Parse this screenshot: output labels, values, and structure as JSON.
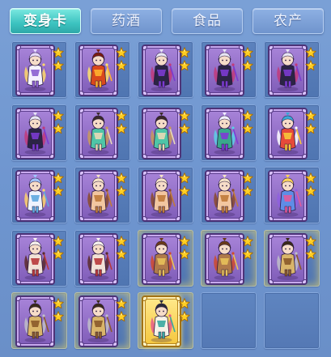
{
  "tabs": [
    {
      "label": "变身卡",
      "active": true
    },
    {
      "label": "药酒",
      "active": false
    },
    {
      "label": "食品",
      "active": false
    },
    {
      "label": "农产",
      "active": false
    }
  ],
  "colors": {
    "panel_bg": "#6f93c9",
    "tab_active": "#3cc3c0",
    "tab_inactive": "#7094cd",
    "card_purple": "#a884d9",
    "card_gold": "#f4c63c",
    "star": "#ffcf24"
  },
  "grid": {
    "columns": 5,
    "rows": 5,
    "slots": [
      {
        "state": "card",
        "frame": "purple",
        "figure": "white-purple-spirit",
        "stars": 2,
        "glow": false
      },
      {
        "state": "card",
        "frame": "purple",
        "figure": "fire-demon",
        "stars": 2,
        "glow": false
      },
      {
        "state": "card",
        "frame": "purple",
        "figure": "dark-swordsman",
        "stars": 2,
        "glow": false
      },
      {
        "state": "card",
        "frame": "purple",
        "figure": "dark-swordsman",
        "stars": 2,
        "glow": false
      },
      {
        "state": "card",
        "frame": "purple",
        "figure": "dark-swordsman",
        "stars": 2,
        "glow": false
      },
      {
        "state": "card",
        "frame": "purple",
        "figure": "dark-swordsman",
        "stars": 2,
        "glow": false
      },
      {
        "state": "card",
        "frame": "purple",
        "figure": "green-maiden",
        "stars": 2,
        "glow": false
      },
      {
        "state": "card",
        "frame": "purple",
        "figure": "green-maiden",
        "stars": 2,
        "glow": false
      },
      {
        "state": "card",
        "frame": "purple",
        "figure": "serpent-dragon",
        "stars": 2,
        "glow": false
      },
      {
        "state": "card",
        "frame": "purple",
        "figure": "lion-dance-beast",
        "stars": 2,
        "glow": false
      },
      {
        "state": "card",
        "frame": "purple",
        "figure": "white-kirin",
        "stars": 2,
        "glow": false
      },
      {
        "state": "card",
        "frame": "purple",
        "figure": "pig-monk",
        "stars": 2,
        "glow": false
      },
      {
        "state": "card",
        "frame": "purple",
        "figure": "pig-monk",
        "stars": 2,
        "glow": false
      },
      {
        "state": "card",
        "frame": "purple",
        "figure": "pig-monk",
        "stars": 2,
        "glow": false
      },
      {
        "state": "card",
        "frame": "purple",
        "figure": "blue-butterfly-fairy",
        "stars": 2,
        "glow": false
      },
      {
        "state": "card",
        "frame": "purple",
        "figure": "red-winged-demon",
        "stars": 2,
        "glow": false
      },
      {
        "state": "card",
        "frame": "purple",
        "figure": "red-winged-demon",
        "stars": 2,
        "glow": false
      },
      {
        "state": "card",
        "frame": "purple",
        "figure": "monkey-warrior",
        "stars": 2,
        "glow": true
      },
      {
        "state": "card",
        "frame": "purple",
        "figure": "monkey-warrior",
        "stars": 2,
        "glow": true
      },
      {
        "state": "card",
        "frame": "purple",
        "figure": "armored-general",
        "stars": 2,
        "glow": true
      },
      {
        "state": "card",
        "frame": "purple",
        "figure": "armored-general",
        "stars": 2,
        "glow": true
      },
      {
        "state": "card",
        "frame": "purple",
        "figure": "armored-general",
        "stars": 2,
        "glow": true
      },
      {
        "state": "card",
        "frame": "gold",
        "figure": "celestial-maiden",
        "stars": 2,
        "glow": true
      },
      {
        "state": "empty"
      },
      {
        "state": "empty"
      }
    ]
  }
}
